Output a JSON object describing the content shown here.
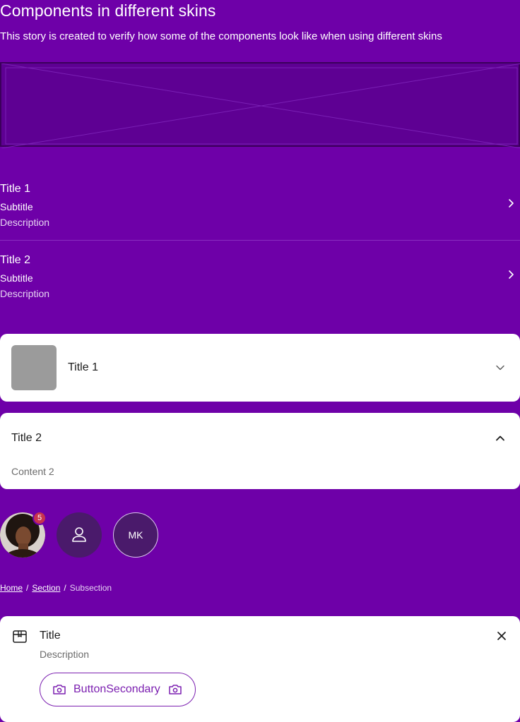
{
  "page": {
    "title": "Components in different skins",
    "description": "This story is created to verify how some of the components look like when using different skins"
  },
  "rows": [
    {
      "title": "Title 1",
      "subtitle": "Subtitle",
      "description": "Description"
    },
    {
      "title": "Title 2",
      "subtitle": "Subtitle",
      "description": "Description"
    }
  ],
  "accordion": [
    {
      "title": "Title 1",
      "expanded": false
    },
    {
      "title": "Title 2",
      "expanded": true,
      "content": "Content 2"
    }
  ],
  "avatars": {
    "badge_count": "5",
    "initials": "MK"
  },
  "breadcrumbs": {
    "items": [
      "Home",
      "Section"
    ],
    "current": "Subsection",
    "separator": "/"
  },
  "callout": {
    "title": "Title",
    "description": "Description",
    "button_label": "ButtonSecondary"
  },
  "colors": {
    "background": "#6e00a8",
    "brand": "#7b1fb0",
    "badge": "#c8334e"
  }
}
